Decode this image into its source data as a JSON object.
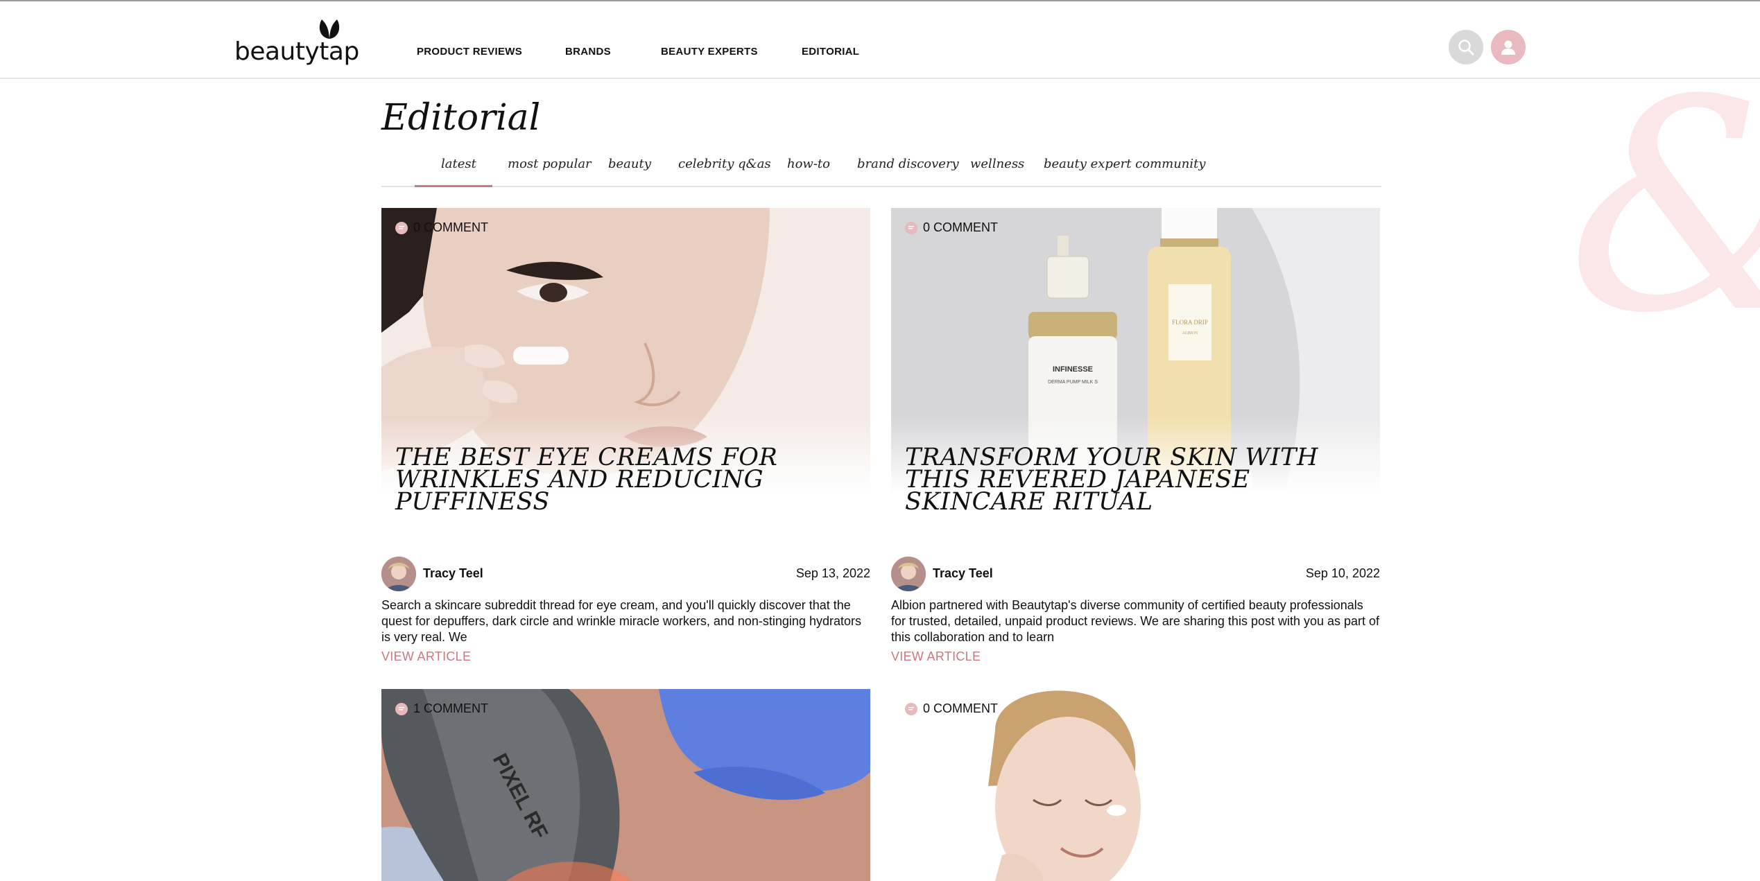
{
  "header": {
    "logo_text": "beautytap",
    "nav": [
      "PRODUCT REVIEWS",
      "BRANDS",
      "BEAUTY EXPERTS",
      "EDITORIAL"
    ],
    "search_icon": "search-icon",
    "user_icon": "user-icon"
  },
  "page": {
    "title": "Editorial",
    "tabs": [
      "latest",
      "most popular",
      "beauty",
      "celebrity q&as",
      "how-to",
      "brand discovery",
      "wellness",
      "beauty expert community"
    ],
    "active_tab": "latest"
  },
  "articles": [
    {
      "comments": "0 COMMENT",
      "title": "THE BEST EYE CREAMS FOR WRINKLES AND REDUCING PUFFINESS",
      "author": "Tracy Teel",
      "date": "Sep 13, 2022",
      "excerpt": "Search a skincare subreddit thread for eye cream, and you'll quickly discover that the quest for depuffers, dark circle and wrinkle miracle workers, and non-stinging hydrators is very real. We",
      "link": "VIEW ARTICLE"
    },
    {
      "comments": "0 COMMENT",
      "title": "TRANSFORM YOUR SKIN WITH THIS REVERED JAPANESE SKINCARE RITUAL",
      "author": "Tracy Teel",
      "date": "Sep 10, 2022",
      "excerpt": "Albion partnered with Beautytap's diverse community of certified beauty professionals for trusted, detailed, unpaid product reviews. We are sharing this post with you as part of this collaboration and to learn",
      "link": "VIEW ARTICLE",
      "product_labels": [
        "INFINESSE",
        "DERMA PUMP MILK S",
        "FLORA DRIP",
        "ALBION"
      ]
    },
    {
      "comments": "1 COMMENT",
      "device_text": "PIXEL RF"
    },
    {
      "comments": "0 COMMENT"
    }
  ],
  "colors": {
    "accent": "#c9787f",
    "pink_light": "#e8b9bf",
    "divider": "#e2e2e2"
  }
}
